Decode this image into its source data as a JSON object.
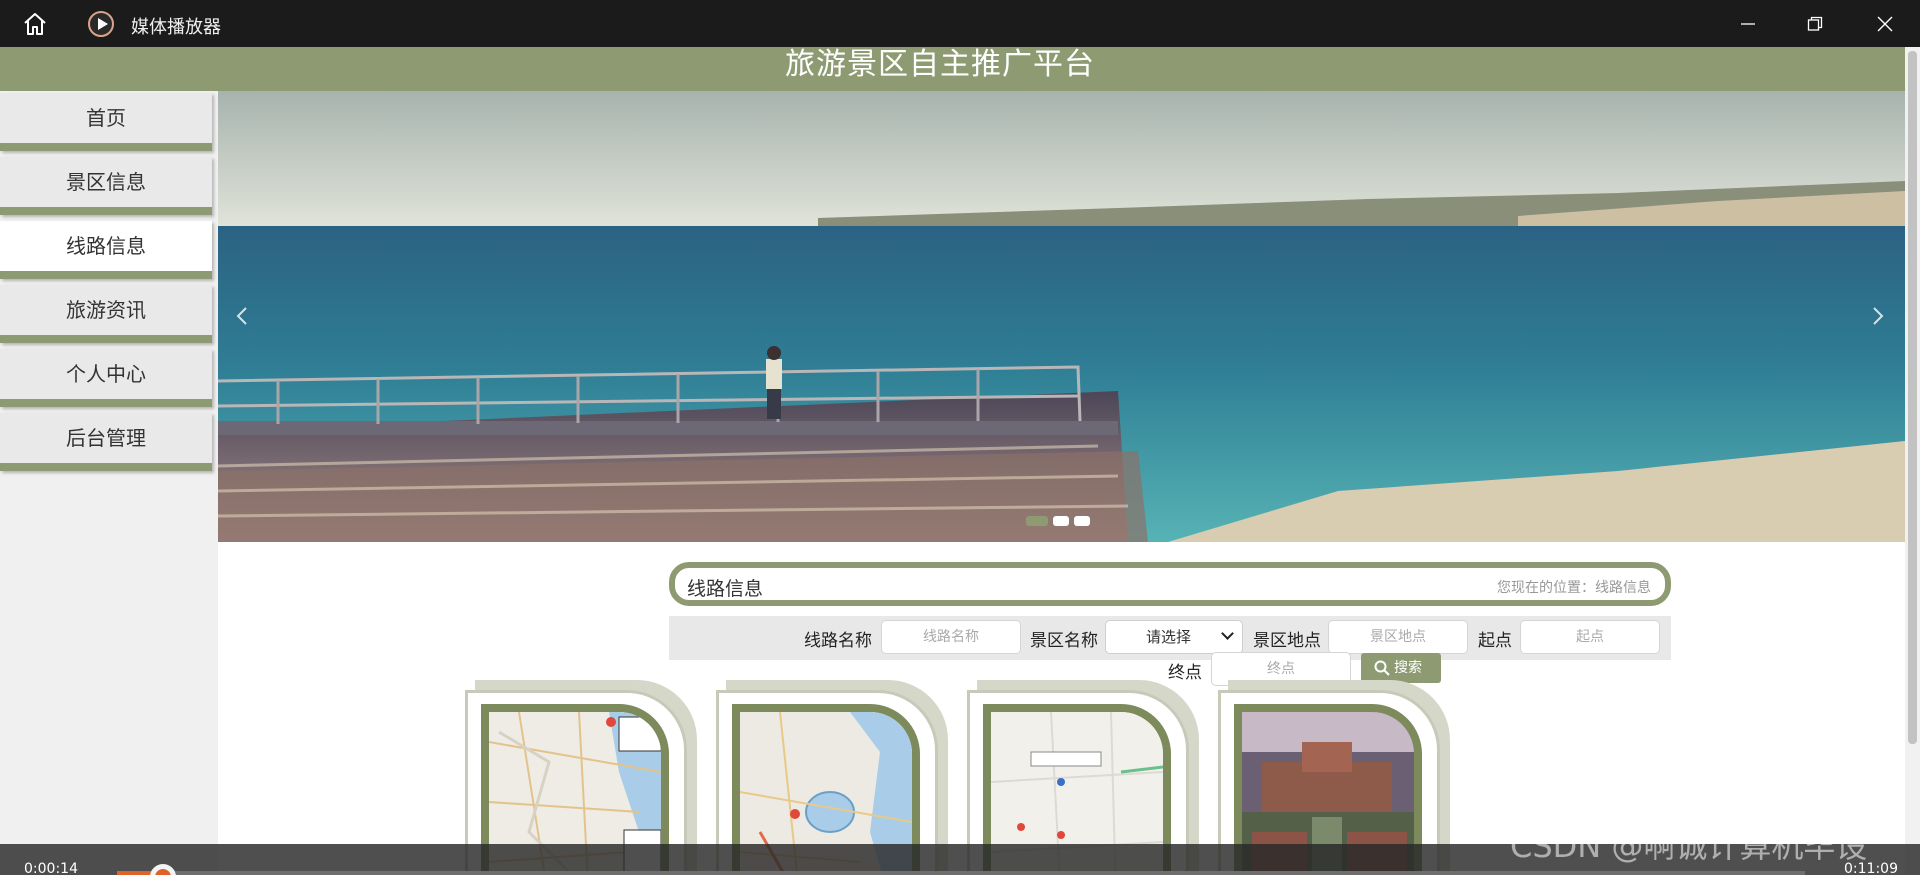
{
  "player": {
    "app_title": "媒体播放器",
    "current_time": "0:00:14",
    "total_time": "0:11:09",
    "progress": 0.021
  },
  "site": {
    "title": "旅游景区自主推广平台"
  },
  "nav": [
    {
      "label": "首页",
      "active": false
    },
    {
      "label": "景区信息",
      "active": false
    },
    {
      "label": "线路信息",
      "active": true
    },
    {
      "label": "旅游资讯",
      "active": false
    },
    {
      "label": "个人中心",
      "active": false
    },
    {
      "label": "后台管理",
      "active": false
    }
  ],
  "banner": {
    "slide_count": 3,
    "active_slide": 0
  },
  "section": {
    "title": "线路信息",
    "position_text": "您现在的位置：线路信息"
  },
  "search": {
    "route_name_label": "线路名称",
    "route_name_placeholder": "线路名称",
    "scenic_name_label": "景区名称",
    "scenic_name_value": "请选择",
    "location_label": "景区地点",
    "location_placeholder": "景区地点",
    "start_label": "起点",
    "start_placeholder": "起点",
    "end_label": "终点",
    "end_placeholder": "终点",
    "button_label": "搜索"
  },
  "cards": [
    {
      "icon": "map-image"
    },
    {
      "icon": "map-image"
    },
    {
      "icon": "map-image"
    },
    {
      "icon": "campus-photo"
    }
  ],
  "watermark": "CSDN @啊诚计算机毕设",
  "colors": {
    "accent": "#8e9a72",
    "progress": "#e0622b",
    "titlebar": "#1b1b1b"
  }
}
